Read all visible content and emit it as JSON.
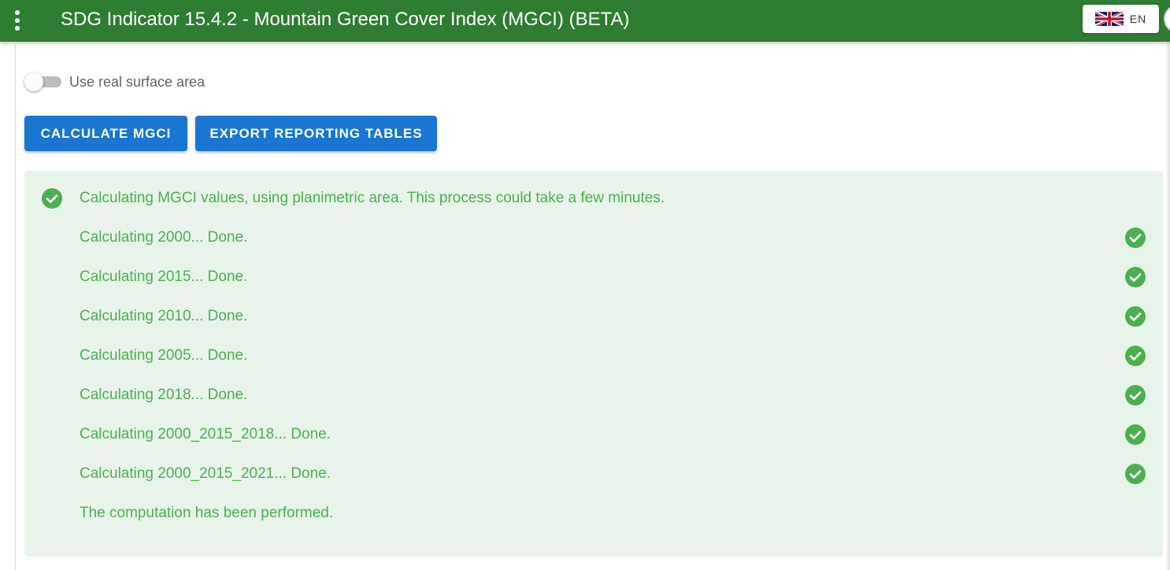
{
  "app_bar": {
    "title": "SDG Indicator 15.4.2 - Mountain Green Cover Index (MGCI) (BETA)",
    "menu_icon": "more-vert-icon",
    "language": {
      "label": "EN",
      "flag_icon": "uk-flag-icon"
    },
    "color": "#2e7d32"
  },
  "options": {
    "real_surface_area": {
      "label": "Use real surface area",
      "enabled": false
    }
  },
  "actions": {
    "calculate_label": "CALCULATE MGCI",
    "export_label": "EXPORT REPORTING TABLES",
    "color": "#1976d2"
  },
  "alert": {
    "status": "success",
    "icon": "check-circle-icon",
    "message": "Calculating MGCI values, using planimetric area. This process could take a few minutes.",
    "steps": [
      {
        "text": "Calculating 2000... Done.",
        "done": true
      },
      {
        "text": "Calculating 2015... Done.",
        "done": true
      },
      {
        "text": "Calculating 2010... Done.",
        "done": true
      },
      {
        "text": "Calculating 2005... Done.",
        "done": true
      },
      {
        "text": "Calculating 2018... Done.",
        "done": true
      },
      {
        "text": "Calculating 2000_2015_2018... Done.",
        "done": true
      },
      {
        "text": "Calculating 2000_2015_2021... Done.",
        "done": true
      }
    ],
    "footer": "The computation has been performed.",
    "background": "#e8f4ea",
    "text_color": "#4caf50"
  }
}
